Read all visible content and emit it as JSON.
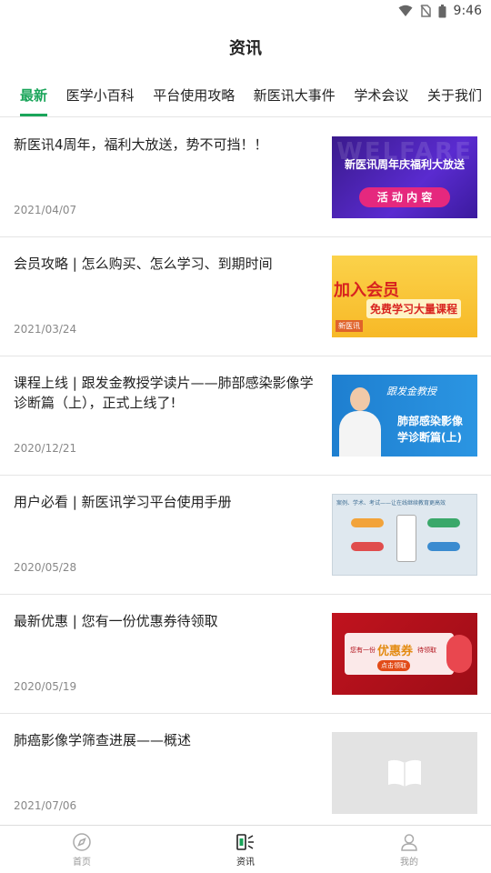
{
  "status_bar": {
    "time": "9:46",
    "icons": [
      "wifi-icon",
      "no-sim-icon",
      "battery-icon"
    ]
  },
  "header": {
    "title": "资讯"
  },
  "tabs": [
    {
      "label": "最新",
      "active": true
    },
    {
      "label": "医学小百科",
      "active": false
    },
    {
      "label": "平台使用攻略",
      "active": false
    },
    {
      "label": "新医讯大事件",
      "active": false
    },
    {
      "label": "学术会议",
      "active": false
    },
    {
      "label": "关于我们",
      "active": false
    }
  ],
  "articles": [
    {
      "title": "新医讯4周年，福利大放送，势不可挡！！",
      "date": "2021/04/07",
      "thumb": {
        "line1": "WELFARE",
        "line2": "新医讯周年庆福利大放送",
        "line3": "活 动 内 容"
      }
    },
    {
      "title": "会员攻略 | 怎么购买、怎么学习、到期时间",
      "date": "2021/03/24",
      "thumb": {
        "line1": "加入会员",
        "line2": "免费学习大量课程",
        "line3": "新医讯"
      }
    },
    {
      "title": "课程上线 | 跟发金教授学读片——肺部感染影像学诊断篇（上），正式上线了!",
      "date": "2020/12/21",
      "thumb": {
        "line1": "跟发金教授",
        "line2": "肺部感染影像",
        "line3": "学诊断篇(上)"
      }
    },
    {
      "title": "用户必看 | 新医讯学习平台使用手册",
      "date": "2020/05/28",
      "thumb": {
        "line1": "案例、学术、考试——让在线继续教育更高效"
      }
    },
    {
      "title": "最新优惠 | 您有一份优惠券待领取",
      "date": "2020/05/19",
      "thumb": {
        "line1": "您有一份",
        "line2": "优惠券",
        "line3": "待领取",
        "line4": "点击领取"
      }
    },
    {
      "title": "肺癌影像学筛查进展——概述",
      "date": "2021/07/06",
      "thumb": {
        "placeholder": "book-icon"
      }
    }
  ],
  "bottom_nav": [
    {
      "label": "首页",
      "icon": "compass-icon",
      "active": false
    },
    {
      "label": "资讯",
      "icon": "news-speaker-icon",
      "active": true
    },
    {
      "label": "我的",
      "icon": "user-icon",
      "active": false
    }
  ],
  "colors": {
    "accent": "#1aa55a",
    "divider": "#e5e5e5",
    "date_text": "#888888"
  }
}
